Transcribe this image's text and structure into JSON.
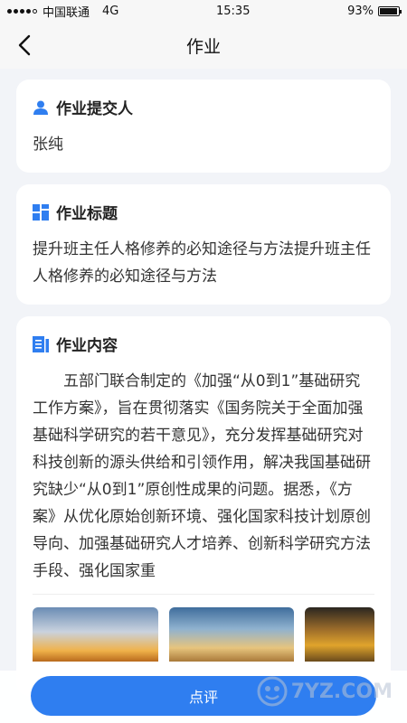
{
  "status_bar": {
    "carrier": "中国联通",
    "network": "4G",
    "time": "15:35",
    "battery": "93%",
    "battery_level": 0.93
  },
  "nav": {
    "title": "作业",
    "back_icon": "chevron-left-icon"
  },
  "submitter": {
    "heading": "作业提交人",
    "icon": "person-icon",
    "name": "张纯"
  },
  "title_section": {
    "heading": "作业标题",
    "icon": "grid-icon",
    "text": "提升班主任人格修养的必知途径与方法提升班主任人格修养的必知途径与方法"
  },
  "content_section": {
    "heading": "作业内容",
    "icon": "document-icon",
    "text": "五部门联合制定的《加强“从0到1”基础研究工作方案》，旨在贯彻落实《国务院关于全面加强基础科学研究的若干意见》，充分发挥基础研究对科技创新的源头供给和引领作用，解决我国基础研究缺少“从0到1”原创性成果的问题。据悉，《方案》从优化原始创新环境、强化国家科技计划原创导向、加强基础研究人才培养、创新科学研究方法手段、强化国家重"
  },
  "footer": {
    "comment_label": "点评",
    "watermark": "7YZ.COM"
  },
  "colors": {
    "accent": "#2f7ef0",
    "background": "#f2f4f8"
  }
}
